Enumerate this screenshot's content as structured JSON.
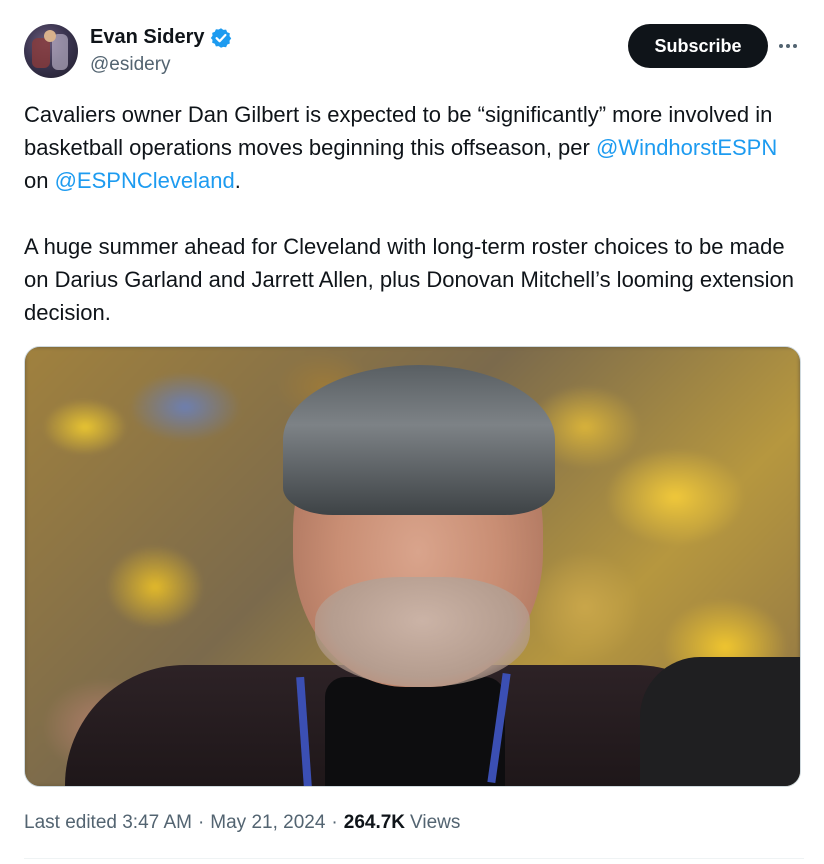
{
  "author": {
    "display_name": "Evan Sidery",
    "handle": "@esidery",
    "verified": true
  },
  "actions": {
    "subscribe_label": "Subscribe"
  },
  "tweet": {
    "p1_part1": "Cavaliers owner Dan Gilbert is expected to be “significantly” more involved in basketball operations moves beginning this offseason, per ",
    "mention1": "@WindhorstESPN",
    "p1_part2": " on ",
    "mention2": "@ESPNCleveland",
    "p1_part3": ".",
    "p2": "A huge summer ahead for Cleveland with long-term roster choices to be made on Darius Garland and Jarrett Allen, plus Donovan Mitchell’s looming extension decision."
  },
  "meta": {
    "edited": "Last edited 3:47 AM",
    "separator": "·",
    "date": "May 21, 2024",
    "views_count": "264.7K",
    "views_label": "Views"
  },
  "colors": {
    "link": "#1d9bf0",
    "verified": "#1d9bf0",
    "button_bg": "#0f1419",
    "secondary_text": "#536471"
  }
}
